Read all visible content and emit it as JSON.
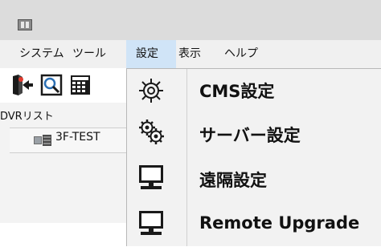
{
  "menubar": {
    "items": [
      {
        "label": "システム"
      },
      {
        "label": "ツール"
      },
      {
        "label": "設定"
      },
      {
        "label": "表示"
      },
      {
        "label": "ヘルプ"
      }
    ],
    "active": "設定"
  },
  "toolbar": {
    "icons": [
      "add-device-icon",
      "search-icon",
      "grid-icon"
    ]
  },
  "left_panel": {
    "title": "DVRリスト",
    "tree": [
      {
        "label": "3F-TEST",
        "icon": "dvr-device-icon"
      }
    ]
  },
  "dropdown": {
    "items": [
      {
        "label": "CMS設定",
        "icon": "gear-icon"
      },
      {
        "label": "サーバー設定",
        "icon": "gears-icon"
      },
      {
        "label": "遠隔設定",
        "icon": "monitor-icon"
      },
      {
        "label": "Remote Upgrade",
        "icon": "monitor-icon"
      }
    ]
  },
  "colors": {
    "menu_highlight": "#d0e4f7",
    "titlebar": "#dcdcdc",
    "dropdown_bg": "#f2f2f2"
  }
}
